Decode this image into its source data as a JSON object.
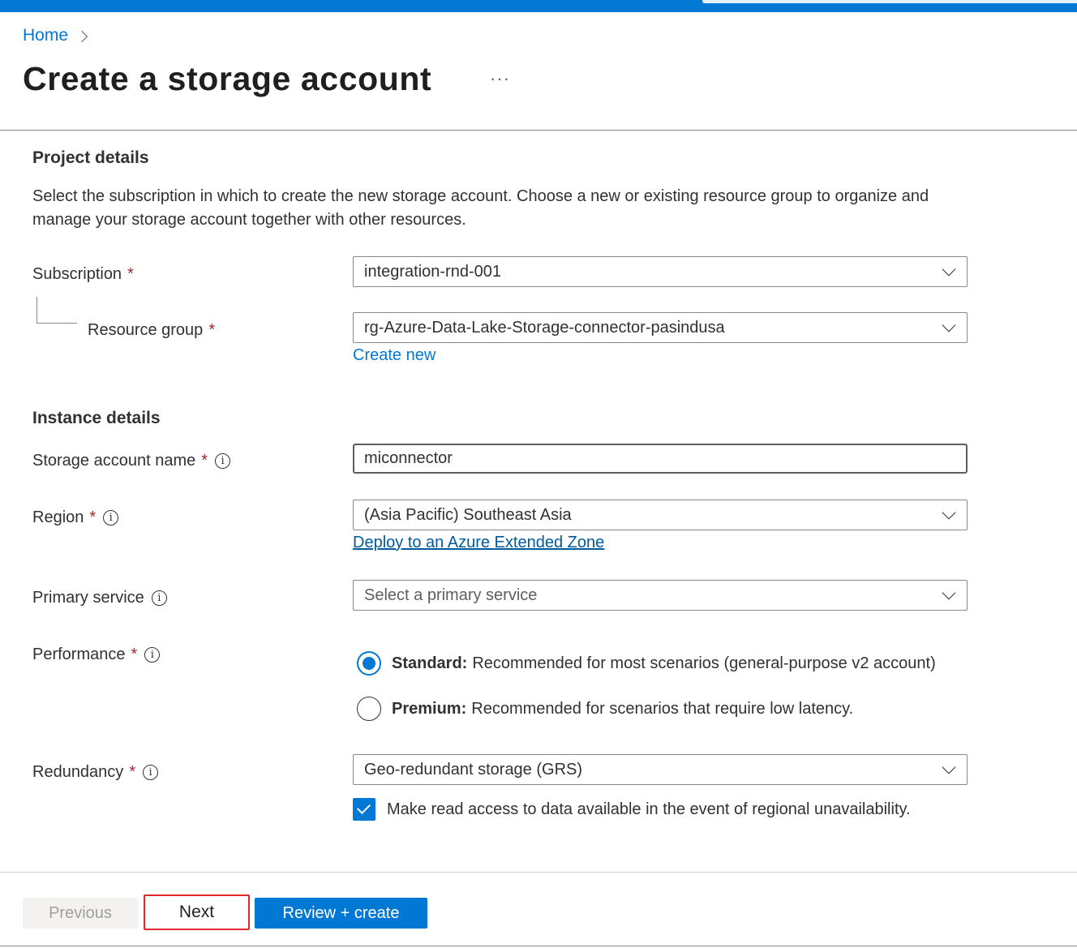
{
  "breadcrumb": {
    "home": "Home"
  },
  "page": {
    "title": "Create a storage account",
    "more": "···"
  },
  "project_details": {
    "heading": "Project details",
    "description": "Select the subscription in which to create the new storage account. Choose a new or existing resource group to organize and manage your storage account together with other resources.",
    "subscription_label": "Subscription",
    "subscription_value": "integration-rnd-001",
    "resource_group_label": "Resource group",
    "resource_group_value": "rg-Azure-Data-Lake-Storage-connector-pasindusa",
    "create_new_link": "Create new",
    "required_mark": "*"
  },
  "instance_details": {
    "heading": "Instance details",
    "storage_account_name_label": "Storage account name",
    "storage_account_name_value": "miconnector",
    "region_label": "Region",
    "region_value": "(Asia Pacific) Southeast Asia",
    "extended_zone_link": "Deploy to an Azure Extended Zone",
    "primary_service_label": "Primary service",
    "primary_service_placeholder": "Select a primary service",
    "performance_label": "Performance",
    "performance_options": [
      {
        "title": "Standard:",
        "desc": "Recommended for most scenarios (general-purpose v2 account)",
        "selected": true
      },
      {
        "title": "Premium:",
        "desc": "Recommended for scenarios that require low latency.",
        "selected": false
      }
    ],
    "redundancy_label": "Redundancy",
    "redundancy_value": "Geo-redundant storage (GRS)",
    "read_access_checkbox": "Make read access to data available in the event of regional unavailability.",
    "read_access_checked": true
  },
  "footer": {
    "previous": "Previous",
    "next": "Next",
    "review_create": "Review + create"
  },
  "colors": {
    "accent": "#0078d4",
    "required": "#a4262c",
    "highlight_border": "#e0282e"
  },
  "icons": {
    "info": "info-icon",
    "chevron_down": "chevron-down-icon",
    "chevron_right": "chevron-right-icon"
  }
}
